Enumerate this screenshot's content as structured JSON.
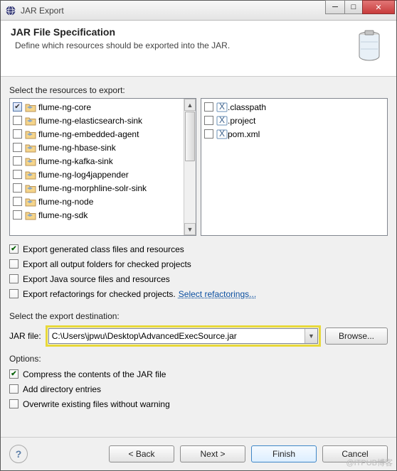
{
  "window": {
    "title": "JAR Export"
  },
  "banner": {
    "title": "JAR File Specification",
    "subtitle": "Define which resources should be exported into the JAR."
  },
  "section_resources_label": "Select the resources to export:",
  "left_tree": [
    {
      "label": "flume-ng-core",
      "checked": "some"
    },
    {
      "label": "flume-ng-elasticsearch-sink",
      "checked": "off"
    },
    {
      "label": "flume-ng-embedded-agent",
      "checked": "off"
    },
    {
      "label": "flume-ng-hbase-sink",
      "checked": "off"
    },
    {
      "label": "flume-ng-kafka-sink",
      "checked": "off"
    },
    {
      "label": "flume-ng-log4jappender",
      "checked": "off"
    },
    {
      "label": "flume-ng-morphline-solr-sink",
      "checked": "off"
    },
    {
      "label": "flume-ng-node",
      "checked": "off"
    },
    {
      "label": "flume-ng-sdk",
      "checked": "off"
    }
  ],
  "right_list": [
    {
      "label": ".classpath"
    },
    {
      "label": ".project"
    },
    {
      "label": "pom.xml"
    }
  ],
  "options1": [
    {
      "label": "Export generated class files and resources",
      "checked": true
    },
    {
      "label": "Export all output folders for checked projects",
      "checked": false
    },
    {
      "label": "Export Java source files and resources",
      "checked": false
    }
  ],
  "refactor_row": {
    "label": "Export refactorings for checked projects.",
    "link": "Select refactorings..."
  },
  "destination": {
    "section_label": "Select the export destination:",
    "field_label": "JAR file:",
    "value": "C:\\Users\\jpwu\\Desktop\\AdvancedExecSource.jar",
    "browse": "Browse..."
  },
  "options2_label": "Options:",
  "options2": [
    {
      "label": "Compress the contents of the JAR file",
      "checked": true
    },
    {
      "label": "Add directory entries",
      "checked": false
    },
    {
      "label": "Overwrite existing files without warning",
      "checked": false
    }
  ],
  "buttons": {
    "back": "< Back",
    "next": "Next >",
    "finish": "Finish",
    "cancel": "Cancel"
  },
  "watermark": "@ITPUB博客"
}
